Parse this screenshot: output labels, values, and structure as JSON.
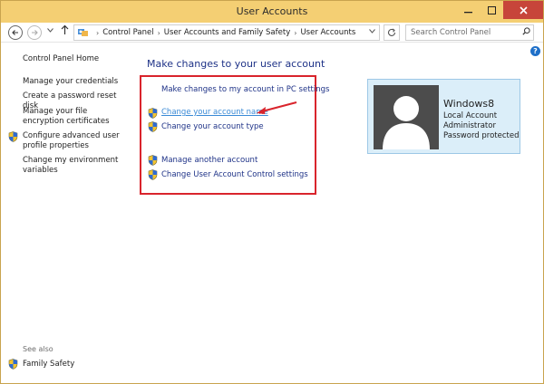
{
  "window": {
    "title": "User Accounts"
  },
  "address": {
    "crumbs": [
      "Control Panel",
      "User Accounts and Family Safety",
      "User Accounts"
    ],
    "search_placeholder": "Search Control Panel"
  },
  "sidebar": {
    "home": "Control Panel Home",
    "links": [
      "Manage your credentials",
      "Create a password reset disk",
      "Manage your file encryption certificates",
      "Configure advanced user profile properties",
      "Change my environment variables"
    ],
    "see_also_label": "See also",
    "family_safety": "Family Safety"
  },
  "main": {
    "title": "Make changes to your user account",
    "tasks": {
      "pc_settings": "Make changes to my account in PC settings",
      "change_name": "Change your account name",
      "change_type": "Change your account type",
      "manage_another": "Manage another account",
      "uac_settings": "Change User Account Control settings"
    }
  },
  "account": {
    "name": "Windows8",
    "type": "Local Account",
    "role": "Administrator",
    "password_status": "Password protected"
  },
  "colors": {
    "titlebar": "#f4cf73",
    "link": "#1e3287",
    "highlight_box": "#d9242c",
    "card_bg": "#dbeef9"
  }
}
